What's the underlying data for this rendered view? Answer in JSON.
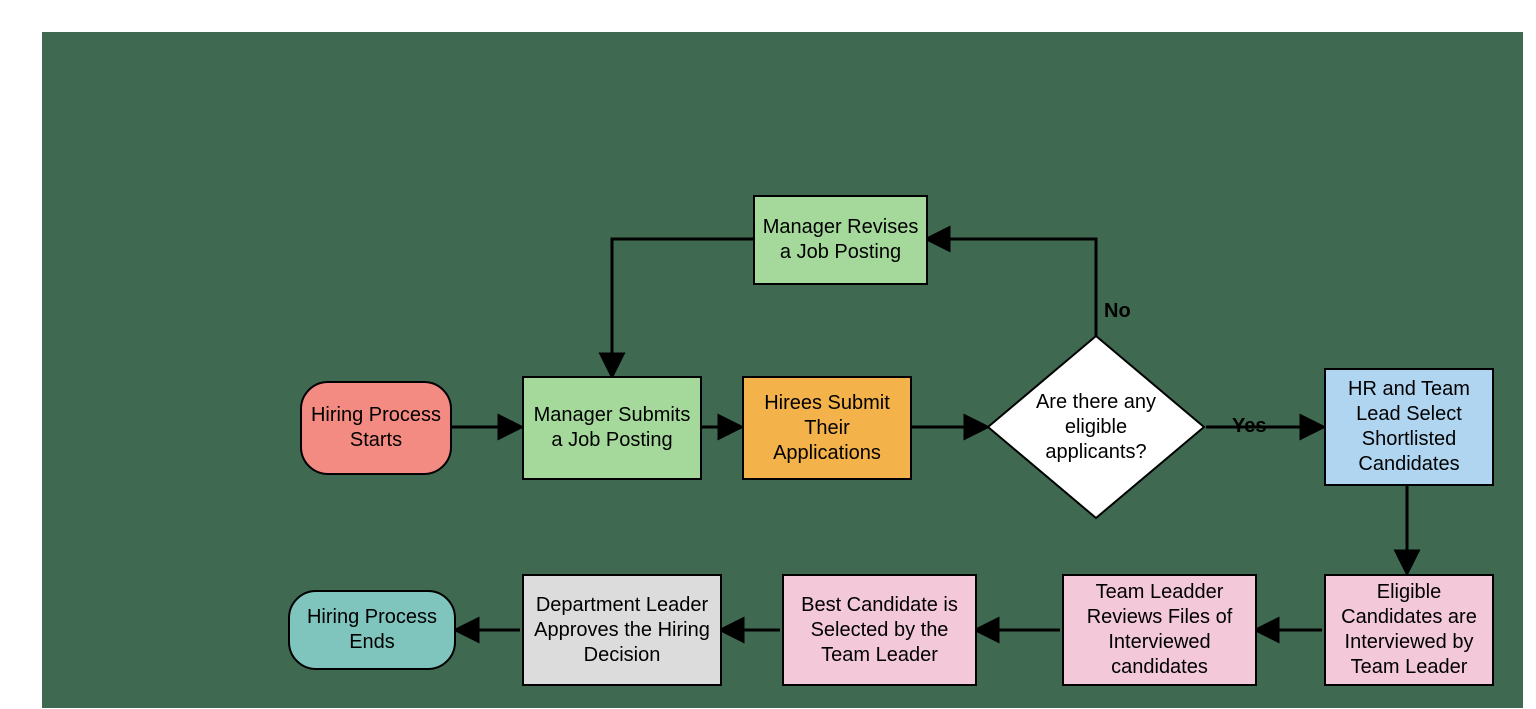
{
  "nodes": {
    "start": "Hiring Process Starts",
    "revise": "Manager Revises a Job Posting",
    "submit": "Manager Submits a Job Posting",
    "hirees": "Hirees Submit Their Applications",
    "decision": "Are there any eligible applicants?",
    "select": "HR and Team Lead Select Shortlisted Candidates",
    "interview": "Eligible Candidates are Interviewed by Team Leader",
    "review": "Team Leadder Reviews  Files of Interviewed candidates",
    "best": "Best Candidate is Selected by the Team Leader",
    "approve": "Department Leader Approves the Hiring Decision",
    "end": "Hiring Process Ends"
  },
  "labels": {
    "no": "No",
    "yes": "Yes"
  },
  "colors": {
    "start": "#f48b82",
    "green": "#a5d99b",
    "orange": "#f4b24a",
    "decision": "#ffffff",
    "blue": "#b0d5f0",
    "pink": "#f3c8d9",
    "gray": "#dcdcdc",
    "end": "#7fc4bd"
  }
}
